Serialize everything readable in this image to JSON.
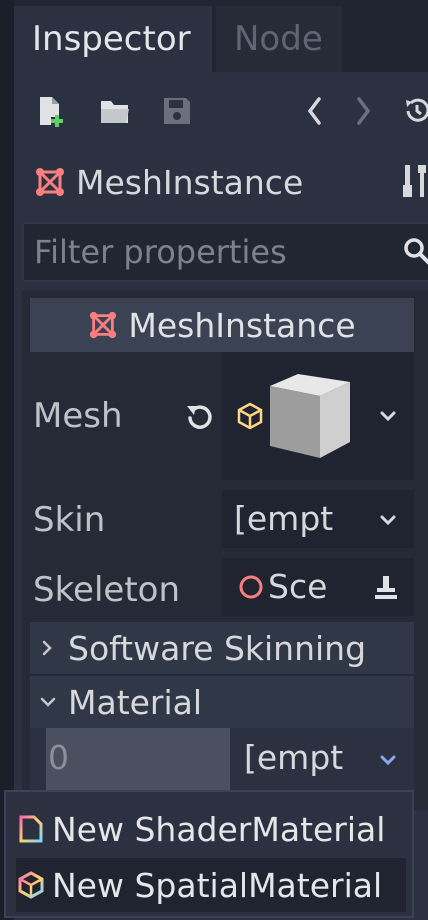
{
  "tabs": [
    {
      "label": "Inspector",
      "active": true
    },
    {
      "label": "Node",
      "active": false
    }
  ],
  "toolbar": {
    "icons": [
      "new-resource-icon",
      "open-folder-icon",
      "save-icon",
      "history-back-icon",
      "history-forward-icon",
      "object-history-icon"
    ]
  },
  "object": {
    "name": "MeshInstance",
    "icon": "mesh-instance-icon"
  },
  "filter": {
    "placeholder": "Filter properties",
    "value": ""
  },
  "section": {
    "title": "MeshInstance"
  },
  "properties": {
    "mesh_label": "Mesh",
    "skin_label": "Skin",
    "skin_value": "[empt",
    "skeleton_label": "Skeleton",
    "skeleton_value": "Sce"
  },
  "groups": {
    "software_skinning": "Software Skinning",
    "material": "Material"
  },
  "material_slot": {
    "index": "0",
    "value": "[empt"
  },
  "popup_menu": {
    "items": [
      {
        "label": "New ShaderMaterial",
        "icon": "shader-material-icon"
      },
      {
        "label": "New SpatialMaterial",
        "icon": "spatial-material-icon",
        "highlighted": true
      }
    ]
  },
  "colors": {
    "accent_red": "#fc7f7f",
    "accent_gold": "#ffd684",
    "accent_blue": "#8da5f3",
    "panel_bg": "#2b3140",
    "dark_bg": "#202531"
  }
}
